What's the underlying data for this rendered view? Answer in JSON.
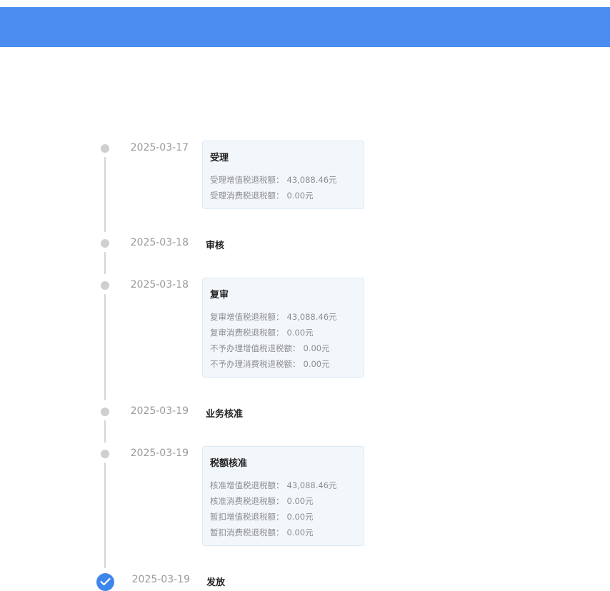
{
  "colors": {
    "header": "#4b8cf0",
    "accent": "#3f86ea",
    "dot": "#cfcfcf"
  },
  "timeline": [
    {
      "date": "2025-03-17",
      "title": "受理",
      "rows": [
        {
          "label": "受理增值税退税额：",
          "value": "43,088.46元"
        },
        {
          "label": "受理消费税退税额：",
          "value": "0.00元"
        }
      ]
    },
    {
      "date": "2025-03-18",
      "title": "审核"
    },
    {
      "date": "2025-03-18",
      "title": "复审",
      "rows": [
        {
          "label": "复审增值税退税额：",
          "value": "43,088.46元"
        },
        {
          "label": "复审消费税退税额：",
          "value": "0.00元"
        },
        {
          "label": "不予办理增值税退税额：",
          "value": "0.00元"
        },
        {
          "label": "不予办理消费税退税额：",
          "value": "0.00元"
        }
      ]
    },
    {
      "date": "2025-03-19",
      "title": "业务核准"
    },
    {
      "date": "2025-03-19",
      "title": "税额核准",
      "rows": [
        {
          "label": "核准增值税退税额：",
          "value": "43,088.46元"
        },
        {
          "label": "核准消费税退税额：",
          "value": "0.00元"
        },
        {
          "label": "暂扣增值税退税额：",
          "value": "0.00元"
        },
        {
          "label": "暂扣消费税退税额：",
          "value": "0.00元"
        }
      ]
    },
    {
      "date": "2025-03-19",
      "title": "发放",
      "icon": "check-circle-icon"
    }
  ]
}
